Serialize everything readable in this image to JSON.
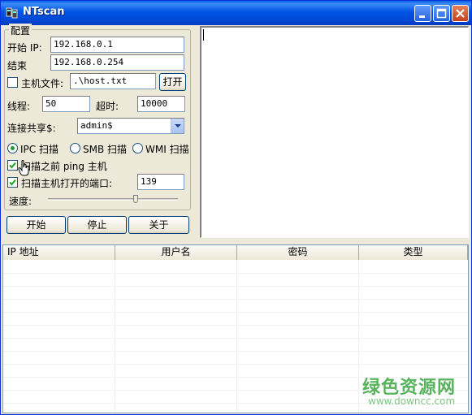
{
  "window": {
    "title": "NTscan"
  },
  "config": {
    "group_label": "配置",
    "start_ip_label": "开始 IP:",
    "start_ip_value": "192.168.0.1",
    "end_label": "结束",
    "end_ip_value": "192.168.0.254",
    "host_file_label": "主机文件:",
    "host_file_checked": false,
    "host_file_value": ".\\host.txt",
    "open_button": "打开",
    "threads_label": "线程:",
    "threads_value": "50",
    "timeout_label": "超时:",
    "timeout_value": "10000",
    "share_label": "连接共享$:",
    "share_value": "admin$",
    "scan_modes": [
      {
        "label": "IPC 扫描",
        "selected": true
      },
      {
        "label": "SMB 扫描",
        "selected": false
      },
      {
        "label": "WMI 扫描",
        "selected": false
      }
    ],
    "ping_label": "扫描之前 ping 主机",
    "ping_checked": true,
    "ports_label": "扫描主机打开的端口:",
    "ports_checked": true,
    "ports_value": "139",
    "speed_label": "速度:",
    "speed_level": 0.68
  },
  "actions": {
    "start": "开始",
    "stop": "停止",
    "about": "关于"
  },
  "table": {
    "columns": [
      "IP 地址",
      "用户名",
      "密码",
      "类型"
    ],
    "rows": []
  },
  "watermark": {
    "cn": "绿色资源网",
    "url": "www.downcc.com"
  },
  "colors": {
    "titlebar": "#0054e3",
    "face": "#ece9d8",
    "watermark": "#3aa640"
  }
}
